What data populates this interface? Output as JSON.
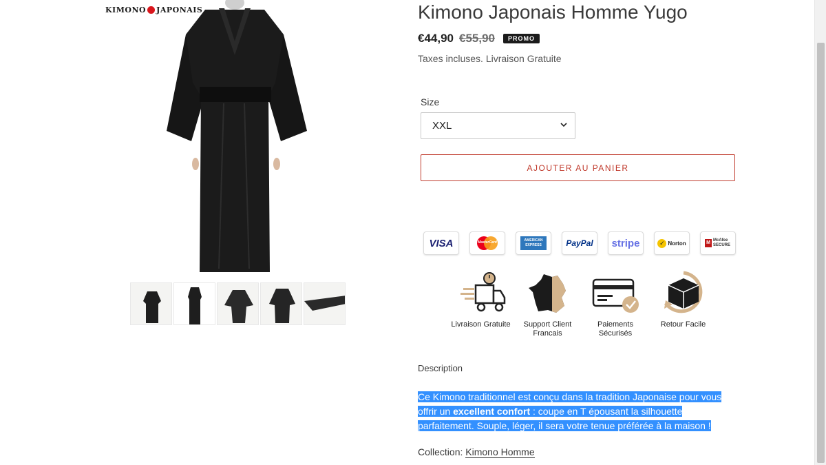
{
  "product": {
    "title": "Kimono Japonais Homme Yugo",
    "price": "€44,90",
    "old_price": "€55,90",
    "badge": "PROMO",
    "tax_note": "Taxes incluses. Livraison Gratuite"
  },
  "brand": {
    "logo_left": "KIMONO",
    "logo_right": "JAPONAIS"
  },
  "size": {
    "label": "Size",
    "selected": "XXL"
  },
  "cart": {
    "button_label": "AJOUTER AU PANIER"
  },
  "payments": [
    {
      "name": "visa-icon",
      "label": "VISA",
      "color": "#1a1f71"
    },
    {
      "name": "mastercard-icon",
      "label": "MasterCard",
      "color": "#eb001b"
    },
    {
      "name": "amex-icon",
      "label": "AMERICAN EXPRESS",
      "color": "#2e77bc"
    },
    {
      "name": "paypal-icon",
      "label": "PayPal",
      "color": "#003087"
    },
    {
      "name": "stripe-icon",
      "label": "stripe",
      "color": "#6772e5"
    },
    {
      "name": "norton-icon",
      "label": "Norton",
      "color": "#f5c400"
    },
    {
      "name": "mcafee-icon",
      "label": "McAfee SECURE",
      "color": "#c01818"
    }
  ],
  "features": [
    {
      "icon": "delivery-truck-icon",
      "label": "Livraison Gratuite"
    },
    {
      "icon": "france-map-icon",
      "label": "Support Client Francais"
    },
    {
      "icon": "secure-card-icon",
      "label": "Paiements Sécurisés"
    },
    {
      "icon": "return-box-icon",
      "label": "Retour Facile"
    }
  ],
  "description": {
    "heading": "Description",
    "text_before": "Ce Kimono traditionnel est conçu dans la tradition Japonaise pour vous offrir un ",
    "text_bold": "excellent confort",
    "text_after": " : coupe en T épousant la silhouette parfaitement. Souple, léger, il sera votre tenue préférée à la maison !"
  },
  "collection": {
    "label": "Collection:",
    "link": "Kimono Homme"
  },
  "colors": {
    "accent": "#c0392b",
    "selection": "#3390ff",
    "feature_tan": "#d4b48c"
  }
}
